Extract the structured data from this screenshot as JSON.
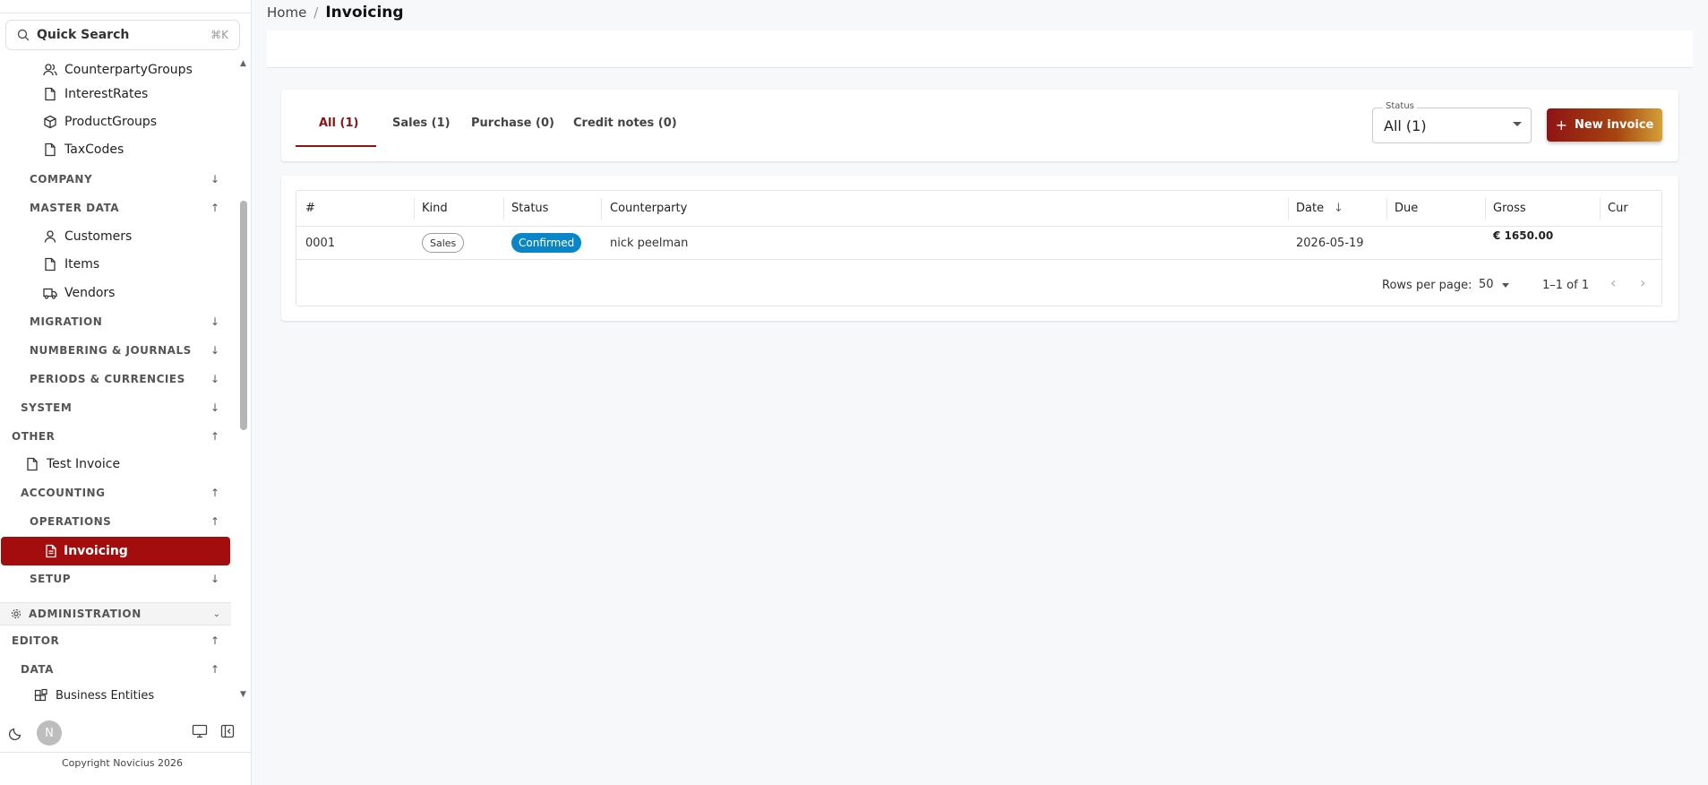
{
  "sidebar": {
    "search": {
      "label": "Quick Search",
      "shortcut": "⌘K"
    },
    "items": {
      "counterparty_groups": "CounterpartyGroups",
      "interest_rates": "InterestRates",
      "product_groups": "ProductGroups",
      "tax_codes": "TaxCodes",
      "company": "COMPANY",
      "master_data": "MASTER DATA",
      "customers": "Customers",
      "items": "Items",
      "vendors": "Vendors",
      "migration": "MIGRATION",
      "numbering": "NUMBERING & JOURNALS",
      "periods": "PERIODS & CURRENCIES",
      "system": "SYSTEM",
      "other": "OTHER",
      "test_invoice": "Test Invoice",
      "accounting": "ACCOUNTING",
      "operations": "OPERATIONS",
      "invoicing": "Invoicing",
      "setup": "SETUP",
      "administration": "ADMINISTRATION",
      "editor": "EDITOR",
      "data": "DATA",
      "business_entities": "Business Entities"
    },
    "avatar_initial": "N",
    "copyright": "Copyright Novicius 2026"
  },
  "breadcrumb": {
    "home": "Home",
    "separator": "/",
    "current": "Invoicing"
  },
  "tabs": [
    {
      "label": "All (1)"
    },
    {
      "label": "Sales (1)"
    },
    {
      "label": "Purchase (0)"
    },
    {
      "label": "Credit notes (0)"
    }
  ],
  "status_filter": {
    "label": "Status",
    "value": "All (1)"
  },
  "new_invoice_label": "New invoice",
  "table": {
    "columns": [
      "#",
      "Kind",
      "Status",
      "Counterparty",
      "Date",
      "Due",
      "Gross",
      "Cur"
    ],
    "rows": [
      {
        "number": "0001",
        "kind": "Sales",
        "status": "Confirmed",
        "counterparty": "nick peelman",
        "date": "2026-05-19",
        "due": "",
        "gross": "€ 1650.00",
        "cur": ""
      }
    ],
    "rows_per_page_label": "Rows per page:",
    "rows_per_page": "50",
    "range": "1–1 of 1"
  },
  "colors": {
    "brand": "#a30d0d",
    "status_confirmed": "#0a86c8"
  }
}
